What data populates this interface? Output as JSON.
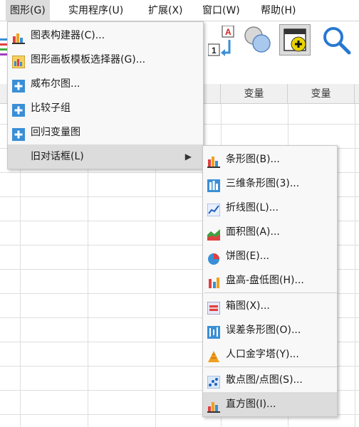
{
  "menubar": {
    "items": [
      {
        "label": "图形(G)"
      },
      {
        "label": "实用程序(U)"
      },
      {
        "label": "扩展(X)"
      },
      {
        "label": "窗口(W)"
      },
      {
        "label": "帮助(H)"
      }
    ]
  },
  "graphs_menu": {
    "items": [
      {
        "label": "图表构建器(C)...",
        "icon": "chart-builder-icon"
      },
      {
        "label": "图形画板模板选择器(G)...",
        "icon": "graphboard-icon"
      },
      {
        "label": "威布尔图...",
        "icon": "plus-icon"
      },
      {
        "label": "比较子组",
        "icon": "plus-icon"
      },
      {
        "label": "回归变量图",
        "icon": "plus-icon"
      },
      {
        "label": "旧对话框(L)",
        "icon": ""
      }
    ]
  },
  "legacy_submenu": {
    "items": [
      {
        "label": "条形图(B)...",
        "icon": "bar-chart-icon"
      },
      {
        "label": "三维条形图(3)...",
        "icon": "3d-bar-chart-icon"
      },
      {
        "label": "折线图(L)...",
        "icon": "line-chart-icon"
      },
      {
        "label": "面积图(A)...",
        "icon": "area-chart-icon"
      },
      {
        "label": "饼图(E)...",
        "icon": "pie-chart-icon"
      },
      {
        "label": "盘高-盘低图(H)...",
        "icon": "high-low-chart-icon"
      },
      {
        "label": "箱图(X)...",
        "icon": "boxplot-icon"
      },
      {
        "label": "误差条形图(O)...",
        "icon": "error-bar-icon"
      },
      {
        "label": "人口金字塔(Y)...",
        "icon": "pyramid-icon"
      },
      {
        "label": "散点图/点图(S)...",
        "icon": "scatter-icon"
      },
      {
        "label": "直方图(I)...",
        "icon": "histogram-icon"
      }
    ]
  },
  "grid": {
    "headers": [
      "变量",
      "变量"
    ]
  },
  "colors": {
    "menu_bg": "#f8f8f8",
    "highlight": "#dcdcdc",
    "plus_icon": "#3a8fd6"
  }
}
